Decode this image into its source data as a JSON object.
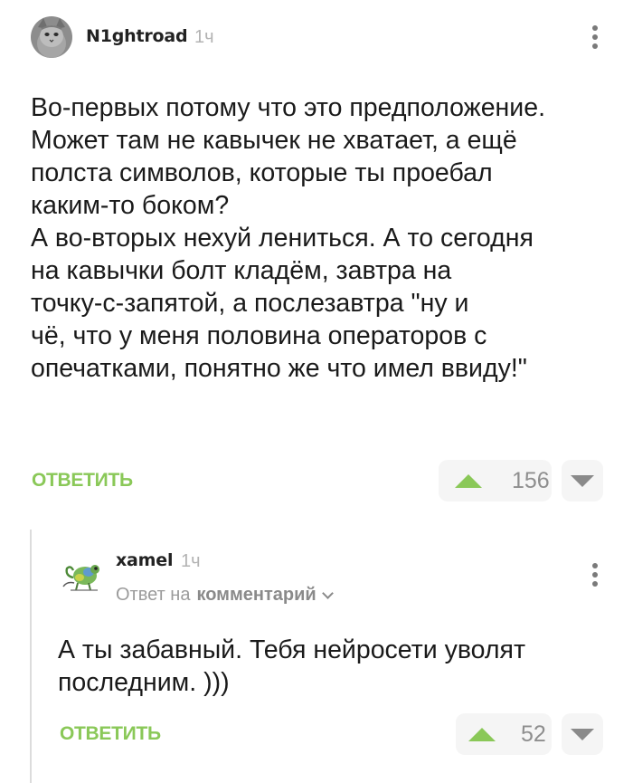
{
  "comments": [
    {
      "author": "N1ghtroad",
      "time": "1ч",
      "avatar_icon": "cat-avatar-icon",
      "text": "Во-первых потому что это предположение.\nМожет там не кавычек не хватает, а ещё\nполста символов, которые ты проебал\nкаким-то боком?\nА во-вторых нехуй лениться. А то сегодня\nна кавычки болт кладём, завтра на\nточку-с-запятой, а послезавтра \"ну и\nчё, что у меня половина операторов с\nопечатками, понятно же что имел ввиду!\"",
      "reply_label": "ОТВЕТИТЬ",
      "rating": "156"
    },
    {
      "author": "xamel",
      "time": "1ч",
      "avatar_icon": "chameleon-avatar-icon",
      "reply_to_prefix": "Ответ на",
      "reply_to_target": "комментарий",
      "text": "А ты забавный. Тебя нейросети уволят\nпоследним. )))",
      "reply_label": "ОТВЕТИТЬ",
      "rating": "52"
    }
  ],
  "colors": {
    "accent_green": "#8ac858",
    "muted_gray": "#8e8e8e",
    "vote_bg": "#f5f5f5"
  }
}
